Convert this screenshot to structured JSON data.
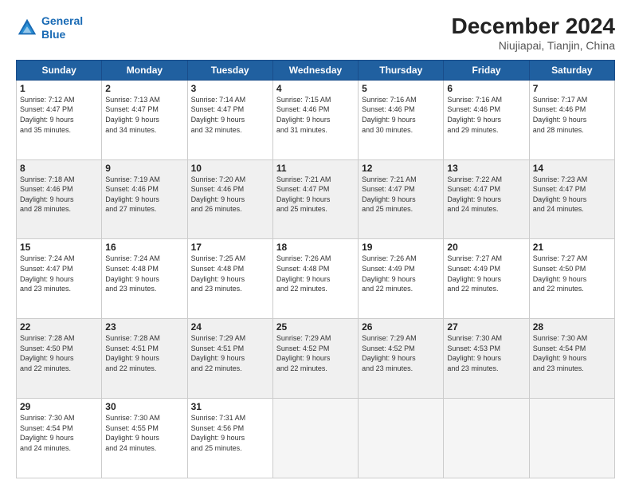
{
  "header": {
    "logo_line1": "General",
    "logo_line2": "Blue",
    "month_year": "December 2024",
    "location": "Niujiapai, Tianjin, China"
  },
  "weekdays": [
    "Sunday",
    "Monday",
    "Tuesday",
    "Wednesday",
    "Thursday",
    "Friday",
    "Saturday"
  ],
  "weeks": [
    [
      {
        "day": "1",
        "info": "Sunrise: 7:12 AM\nSunset: 4:47 PM\nDaylight: 9 hours\nand 35 minutes."
      },
      {
        "day": "2",
        "info": "Sunrise: 7:13 AM\nSunset: 4:47 PM\nDaylight: 9 hours\nand 34 minutes."
      },
      {
        "day": "3",
        "info": "Sunrise: 7:14 AM\nSunset: 4:47 PM\nDaylight: 9 hours\nand 32 minutes."
      },
      {
        "day": "4",
        "info": "Sunrise: 7:15 AM\nSunset: 4:46 PM\nDaylight: 9 hours\nand 31 minutes."
      },
      {
        "day": "5",
        "info": "Sunrise: 7:16 AM\nSunset: 4:46 PM\nDaylight: 9 hours\nand 30 minutes."
      },
      {
        "day": "6",
        "info": "Sunrise: 7:16 AM\nSunset: 4:46 PM\nDaylight: 9 hours\nand 29 minutes."
      },
      {
        "day": "7",
        "info": "Sunrise: 7:17 AM\nSunset: 4:46 PM\nDaylight: 9 hours\nand 28 minutes."
      }
    ],
    [
      {
        "day": "8",
        "info": "Sunrise: 7:18 AM\nSunset: 4:46 PM\nDaylight: 9 hours\nand 28 minutes."
      },
      {
        "day": "9",
        "info": "Sunrise: 7:19 AM\nSunset: 4:46 PM\nDaylight: 9 hours\nand 27 minutes."
      },
      {
        "day": "10",
        "info": "Sunrise: 7:20 AM\nSunset: 4:46 PM\nDaylight: 9 hours\nand 26 minutes."
      },
      {
        "day": "11",
        "info": "Sunrise: 7:21 AM\nSunset: 4:47 PM\nDaylight: 9 hours\nand 25 minutes."
      },
      {
        "day": "12",
        "info": "Sunrise: 7:21 AM\nSunset: 4:47 PM\nDaylight: 9 hours\nand 25 minutes."
      },
      {
        "day": "13",
        "info": "Sunrise: 7:22 AM\nSunset: 4:47 PM\nDaylight: 9 hours\nand 24 minutes."
      },
      {
        "day": "14",
        "info": "Sunrise: 7:23 AM\nSunset: 4:47 PM\nDaylight: 9 hours\nand 24 minutes."
      }
    ],
    [
      {
        "day": "15",
        "info": "Sunrise: 7:24 AM\nSunset: 4:47 PM\nDaylight: 9 hours\nand 23 minutes."
      },
      {
        "day": "16",
        "info": "Sunrise: 7:24 AM\nSunset: 4:48 PM\nDaylight: 9 hours\nand 23 minutes."
      },
      {
        "day": "17",
        "info": "Sunrise: 7:25 AM\nSunset: 4:48 PM\nDaylight: 9 hours\nand 23 minutes."
      },
      {
        "day": "18",
        "info": "Sunrise: 7:26 AM\nSunset: 4:48 PM\nDaylight: 9 hours\nand 22 minutes."
      },
      {
        "day": "19",
        "info": "Sunrise: 7:26 AM\nSunset: 4:49 PM\nDaylight: 9 hours\nand 22 minutes."
      },
      {
        "day": "20",
        "info": "Sunrise: 7:27 AM\nSunset: 4:49 PM\nDaylight: 9 hours\nand 22 minutes."
      },
      {
        "day": "21",
        "info": "Sunrise: 7:27 AM\nSunset: 4:50 PM\nDaylight: 9 hours\nand 22 minutes."
      }
    ],
    [
      {
        "day": "22",
        "info": "Sunrise: 7:28 AM\nSunset: 4:50 PM\nDaylight: 9 hours\nand 22 minutes."
      },
      {
        "day": "23",
        "info": "Sunrise: 7:28 AM\nSunset: 4:51 PM\nDaylight: 9 hours\nand 22 minutes."
      },
      {
        "day": "24",
        "info": "Sunrise: 7:29 AM\nSunset: 4:51 PM\nDaylight: 9 hours\nand 22 minutes."
      },
      {
        "day": "25",
        "info": "Sunrise: 7:29 AM\nSunset: 4:52 PM\nDaylight: 9 hours\nand 22 minutes."
      },
      {
        "day": "26",
        "info": "Sunrise: 7:29 AM\nSunset: 4:52 PM\nDaylight: 9 hours\nand 23 minutes."
      },
      {
        "day": "27",
        "info": "Sunrise: 7:30 AM\nSunset: 4:53 PM\nDaylight: 9 hours\nand 23 minutes."
      },
      {
        "day": "28",
        "info": "Sunrise: 7:30 AM\nSunset: 4:54 PM\nDaylight: 9 hours\nand 23 minutes."
      }
    ],
    [
      {
        "day": "29",
        "info": "Sunrise: 7:30 AM\nSunset: 4:54 PM\nDaylight: 9 hours\nand 24 minutes."
      },
      {
        "day": "30",
        "info": "Sunrise: 7:30 AM\nSunset: 4:55 PM\nDaylight: 9 hours\nand 24 minutes."
      },
      {
        "day": "31",
        "info": "Sunrise: 7:31 AM\nSunset: 4:56 PM\nDaylight: 9 hours\nand 25 minutes."
      },
      null,
      null,
      null,
      null
    ]
  ]
}
